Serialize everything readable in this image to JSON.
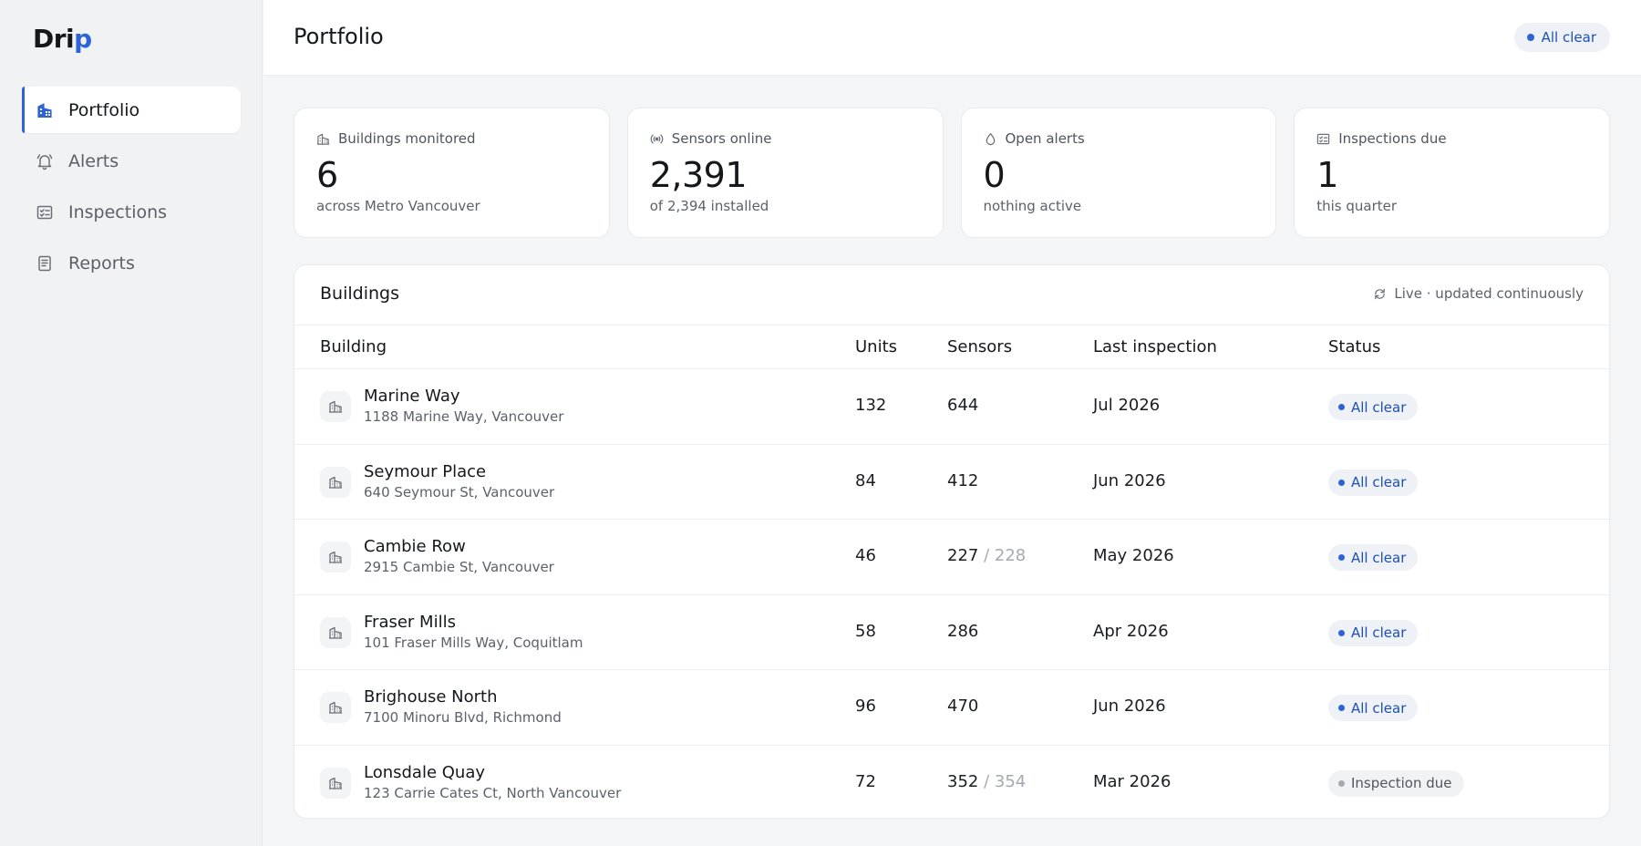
{
  "app": {
    "logo_main": "Dri",
    "logo_accent": "p"
  },
  "sidebar": {
    "items": [
      {
        "label": "Portfolio",
        "icon": "building-icon",
        "active": true
      },
      {
        "label": "Alerts",
        "icon": "bell-icon",
        "active": false
      },
      {
        "label": "Inspections",
        "icon": "checklist-icon",
        "active": false
      },
      {
        "label": "Reports",
        "icon": "document-icon",
        "active": false
      }
    ]
  },
  "header": {
    "title": "Portfolio",
    "status_badge": "All clear"
  },
  "stats": [
    {
      "label": "Buildings monitored",
      "icon": "building-icon",
      "value": "6",
      "sub": "across Metro Vancouver"
    },
    {
      "label": "Sensors online",
      "icon": "signal-icon",
      "value": "2,391",
      "sub": "of 2,394 installed"
    },
    {
      "label": "Open alerts",
      "icon": "drop-icon",
      "value": "0",
      "sub": "nothing active"
    },
    {
      "label": "Inspections due",
      "icon": "checklist-icon",
      "value": "1",
      "sub": "this quarter"
    }
  ],
  "buildings_panel": {
    "title": "Buildings",
    "live_text": "Live · updated continuously",
    "columns": {
      "building": "Building",
      "units": "Units",
      "sensors": "Sensors",
      "last_inspection": "Last inspection",
      "status": "Status"
    },
    "rows": [
      {
        "name": "Marine Way",
        "address": "1188 Marine Way, Vancouver",
        "units": "132",
        "sensors": "644",
        "sensors_total": "",
        "last_inspection": "Jul 2026",
        "status": "All clear",
        "status_type": "clear"
      },
      {
        "name": "Seymour Place",
        "address": "640 Seymour St, Vancouver",
        "units": "84",
        "sensors": "412",
        "sensors_total": "",
        "last_inspection": "Jun 2026",
        "status": "All clear",
        "status_type": "clear"
      },
      {
        "name": "Cambie Row",
        "address": "2915 Cambie St, Vancouver",
        "units": "46",
        "sensors": "227",
        "sensors_total": "/ 228",
        "last_inspection": "May 2026",
        "status": "All clear",
        "status_type": "clear"
      },
      {
        "name": "Fraser Mills",
        "address": "101 Fraser Mills Way, Coquitlam",
        "units": "58",
        "sensors": "286",
        "sensors_total": "",
        "last_inspection": "Apr 2026",
        "status": "All clear",
        "status_type": "clear"
      },
      {
        "name": "Brighouse North",
        "address": "7100 Minoru Blvd, Richmond",
        "units": "96",
        "sensors": "470",
        "sensors_total": "",
        "last_inspection": "Jun 2026",
        "status": "All clear",
        "status_type": "clear"
      },
      {
        "name": "Lonsdale Quay",
        "address": "123 Carrie Cates Ct, North Vancouver",
        "units": "72",
        "sensors": "352",
        "sensors_total": "/ 354",
        "last_inspection": "Mar 2026",
        "status": "Inspection due",
        "status_type": "due"
      }
    ]
  },
  "colors": {
    "accent": "#2e63d8",
    "badge_text": "#1e4fb8",
    "badge_bg": "#eef1f6"
  }
}
